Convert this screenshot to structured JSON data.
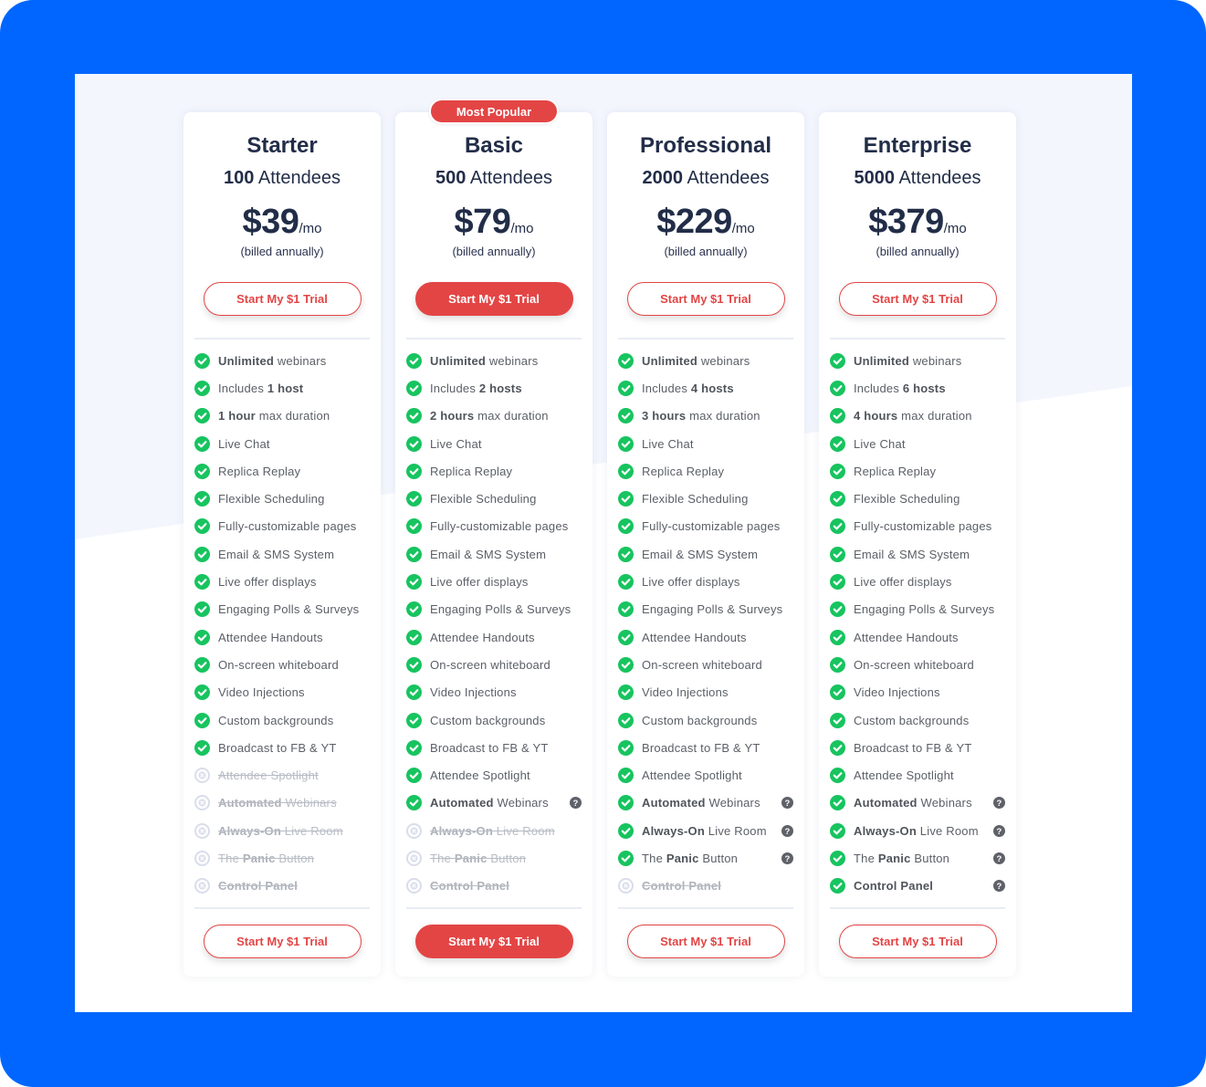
{
  "colors": {
    "frame": "#0066FF",
    "accent": "#E34545",
    "check": "#17C45F",
    "disabled": "#DADDEB",
    "help": "#5F6168",
    "heading": "#222D48"
  },
  "badge_label": "Most Popular",
  "plans": [
    {
      "name": "Starter",
      "attendees_count": "100",
      "attendees_label": "Attendees",
      "price": "$39",
      "period": "/mo",
      "billing": "(billed annually)",
      "cta_label": "Start My $1 Trial",
      "featured": false,
      "features": [
        {
          "bold": "Unlimited",
          "text": " webinars",
          "included": true,
          "help": false,
          "bold_first": true
        },
        {
          "pre": "Includes ",
          "bold": "1 host",
          "included": true,
          "help": false
        },
        {
          "bold": "1 hour",
          "text": " max duration",
          "included": true,
          "help": false,
          "bold_first": true
        },
        {
          "text": "Live Chat",
          "included": true,
          "help": false
        },
        {
          "text": "Replica Replay",
          "included": true,
          "help": false
        },
        {
          "text": "Flexible Scheduling",
          "included": true,
          "help": false
        },
        {
          "text": "Fully-customizable pages",
          "included": true,
          "help": false
        },
        {
          "text": "Email & SMS System",
          "included": true,
          "help": false
        },
        {
          "text": "Live offer displays",
          "included": true,
          "help": false
        },
        {
          "text": "Engaging Polls & Surveys",
          "included": true,
          "help": false
        },
        {
          "text": "Attendee Handouts",
          "included": true,
          "help": false
        },
        {
          "text": "On-screen whiteboard",
          "included": true,
          "help": false
        },
        {
          "text": "Video Injections",
          "included": true,
          "help": false
        },
        {
          "text": "Custom backgrounds",
          "included": true,
          "help": false
        },
        {
          "text": "Broadcast to FB & YT",
          "included": true,
          "help": false
        },
        {
          "text": "Attendee Spotlight",
          "included": false,
          "help": false
        },
        {
          "bold": "Automated",
          "text": " Webinars",
          "included": false,
          "help": false,
          "bold_first": true
        },
        {
          "bold": "Always-On",
          "text": " Live Room",
          "included": false,
          "help": false,
          "bold_first": true
        },
        {
          "pre": "The ",
          "bold": "Panic",
          "text": " Button",
          "included": false,
          "help": false
        },
        {
          "bold": "Control Panel",
          "included": false,
          "help": false,
          "bold_first": true
        }
      ]
    },
    {
      "name": "Basic",
      "attendees_count": "500",
      "attendees_label": "Attendees",
      "price": "$79",
      "period": "/mo",
      "billing": "(billed annually)",
      "cta_label": "Start My $1 Trial",
      "featured": true,
      "features": [
        {
          "bold": "Unlimited",
          "text": " webinars",
          "included": true,
          "help": false,
          "bold_first": true
        },
        {
          "pre": "Includes ",
          "bold": "2 hosts",
          "included": true,
          "help": false
        },
        {
          "bold": "2 hours",
          "text": " max duration",
          "included": true,
          "help": false,
          "bold_first": true
        },
        {
          "text": "Live Chat",
          "included": true,
          "help": false
        },
        {
          "text": "Replica Replay",
          "included": true,
          "help": false
        },
        {
          "text": "Flexible Scheduling",
          "included": true,
          "help": false
        },
        {
          "text": "Fully-customizable pages",
          "included": true,
          "help": false
        },
        {
          "text": "Email & SMS System",
          "included": true,
          "help": false
        },
        {
          "text": "Live offer displays",
          "included": true,
          "help": false
        },
        {
          "text": "Engaging Polls & Surveys",
          "included": true,
          "help": false
        },
        {
          "text": "Attendee Handouts",
          "included": true,
          "help": false
        },
        {
          "text": "On-screen whiteboard",
          "included": true,
          "help": false
        },
        {
          "text": "Video Injections",
          "included": true,
          "help": false
        },
        {
          "text": "Custom backgrounds",
          "included": true,
          "help": false
        },
        {
          "text": "Broadcast to FB & YT",
          "included": true,
          "help": false
        },
        {
          "text": "Attendee Spotlight",
          "included": true,
          "help": false
        },
        {
          "bold": "Automated",
          "text": " Webinars",
          "included": true,
          "help": true,
          "bold_first": true
        },
        {
          "bold": "Always-On",
          "text": " Live Room",
          "included": false,
          "help": false,
          "bold_first": true
        },
        {
          "pre": "The ",
          "bold": "Panic",
          "text": " Button",
          "included": false,
          "help": false
        },
        {
          "bold": "Control Panel",
          "included": false,
          "help": false,
          "bold_first": true
        }
      ]
    },
    {
      "name": "Professional",
      "attendees_count": "2000",
      "attendees_label": "Attendees",
      "price": "$229",
      "period": "/mo",
      "billing": "(billed annually)",
      "cta_label": "Start My $1 Trial",
      "featured": false,
      "features": [
        {
          "bold": "Unlimited",
          "text": " webinars",
          "included": true,
          "help": false,
          "bold_first": true
        },
        {
          "pre": "Includes ",
          "bold": "4 hosts",
          "included": true,
          "help": false
        },
        {
          "bold": "3 hours",
          "text": " max duration",
          "included": true,
          "help": false,
          "bold_first": true
        },
        {
          "text": "Live Chat",
          "included": true,
          "help": false
        },
        {
          "text": "Replica Replay",
          "included": true,
          "help": false
        },
        {
          "text": "Flexible Scheduling",
          "included": true,
          "help": false
        },
        {
          "text": "Fully-customizable pages",
          "included": true,
          "help": false
        },
        {
          "text": "Email & SMS System",
          "included": true,
          "help": false
        },
        {
          "text": "Live offer displays",
          "included": true,
          "help": false
        },
        {
          "text": "Engaging Polls & Surveys",
          "included": true,
          "help": false
        },
        {
          "text": "Attendee Handouts",
          "included": true,
          "help": false
        },
        {
          "text": "On-screen whiteboard",
          "included": true,
          "help": false
        },
        {
          "text": "Video Injections",
          "included": true,
          "help": false
        },
        {
          "text": "Custom backgrounds",
          "included": true,
          "help": false
        },
        {
          "text": "Broadcast to FB & YT",
          "included": true,
          "help": false
        },
        {
          "text": "Attendee Spotlight",
          "included": true,
          "help": false
        },
        {
          "bold": "Automated",
          "text": " Webinars",
          "included": true,
          "help": true,
          "bold_first": true
        },
        {
          "bold": "Always-On",
          "text": " Live Room",
          "included": true,
          "help": true,
          "bold_first": true
        },
        {
          "pre": "The ",
          "bold": "Panic",
          "text": " Button",
          "included": true,
          "help": true
        },
        {
          "bold": "Control Panel",
          "included": false,
          "help": false,
          "bold_first": true
        }
      ]
    },
    {
      "name": "Enterprise",
      "attendees_count": "5000",
      "attendees_label": "Attendees",
      "price": "$379",
      "period": "/mo",
      "billing": "(billed annually)",
      "cta_label": "Start My $1 Trial",
      "featured": false,
      "features": [
        {
          "bold": "Unlimited",
          "text": " webinars",
          "included": true,
          "help": false,
          "bold_first": true
        },
        {
          "pre": "Includes ",
          "bold": "6 hosts",
          "included": true,
          "help": false
        },
        {
          "bold": "4 hours",
          "text": " max duration",
          "included": true,
          "help": false,
          "bold_first": true
        },
        {
          "text": "Live Chat",
          "included": true,
          "help": false
        },
        {
          "text": "Replica Replay",
          "included": true,
          "help": false
        },
        {
          "text": "Flexible Scheduling",
          "included": true,
          "help": false
        },
        {
          "text": "Fully-customizable pages",
          "included": true,
          "help": false
        },
        {
          "text": "Email & SMS System",
          "included": true,
          "help": false
        },
        {
          "text": "Live offer displays",
          "included": true,
          "help": false
        },
        {
          "text": "Engaging Polls & Surveys",
          "included": true,
          "help": false
        },
        {
          "text": "Attendee Handouts",
          "included": true,
          "help": false
        },
        {
          "text": "On-screen whiteboard",
          "included": true,
          "help": false
        },
        {
          "text": "Video Injections",
          "included": true,
          "help": false
        },
        {
          "text": "Custom backgrounds",
          "included": true,
          "help": false
        },
        {
          "text": "Broadcast to FB & YT",
          "included": true,
          "help": false
        },
        {
          "text": "Attendee Spotlight",
          "included": true,
          "help": false
        },
        {
          "bold": "Automated",
          "text": " Webinars",
          "included": true,
          "help": true,
          "bold_first": true
        },
        {
          "bold": "Always-On",
          "text": " Live Room",
          "included": true,
          "help": true,
          "bold_first": true
        },
        {
          "pre": "The ",
          "bold": "Panic",
          "text": " Button",
          "included": true,
          "help": true
        },
        {
          "bold": "Control Panel",
          "included": true,
          "help": true,
          "bold_first": true
        }
      ]
    }
  ],
  "icons": {
    "included": "check-circle-icon",
    "excluded": "x-circle-icon",
    "help": "question-circle-icon"
  }
}
